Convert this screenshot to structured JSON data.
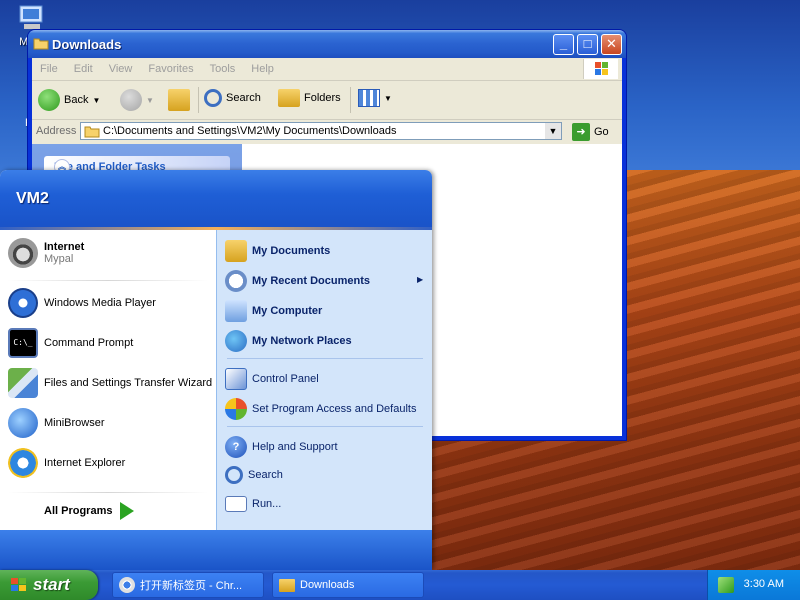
{
  "desktop": {
    "icons": [
      {
        "label": "My C",
        "icon": "my-computer-icon"
      },
      {
        "label": "Re",
        "icon": "recycle-bin-icon"
      }
    ]
  },
  "explorer": {
    "title": "Downloads",
    "menus": [
      "File",
      "Edit",
      "View",
      "Favorites",
      "Tools",
      "Help"
    ],
    "toolbar": {
      "back": "Back",
      "search": "Search",
      "folders": "Folders"
    },
    "address": {
      "label": "Address",
      "value": "C:\\Documents and Settings\\VM2\\My Documents\\Downloads",
      "go": "Go"
    },
    "tasks": {
      "header": "File and Folder Tasks"
    }
  },
  "start_menu": {
    "user": "VM2",
    "left": {
      "pinned": [
        {
          "label": "Internet",
          "sub": "Mypal",
          "icon": "raccoon-icon"
        }
      ],
      "recent": [
        {
          "label": "Windows Media Player",
          "icon": "media-player-icon"
        },
        {
          "label": "Command Prompt",
          "icon": "command-prompt-icon"
        },
        {
          "label": "Files and Settings Transfer Wizard",
          "icon": "transfer-wizard-icon"
        },
        {
          "label": "MiniBrowser",
          "icon": "minibrowser-icon"
        },
        {
          "label": "Internet Explorer",
          "icon": "ie-icon"
        }
      ],
      "all_programs": "All Programs"
    },
    "right": {
      "items": [
        {
          "label": "My Documents",
          "bold": true,
          "icon": "my-documents-icon"
        },
        {
          "label": "My Recent Documents",
          "bold": true,
          "icon": "recent-documents-icon"
        },
        {
          "label": "My Computer",
          "bold": true,
          "icon": "my-computer-icon"
        },
        {
          "label": "My Network Places",
          "bold": true,
          "icon": "network-places-icon"
        },
        {
          "label": "Control Panel",
          "bold": false,
          "icon": "control-panel-icon"
        },
        {
          "label": "Set Program Access and Defaults",
          "bold": false,
          "icon": "program-access-icon"
        },
        {
          "label": "Help and Support",
          "bold": false,
          "icon": "help-icon"
        },
        {
          "label": "Search",
          "bold": false,
          "icon": "search-icon"
        },
        {
          "label": "Run...",
          "bold": false,
          "icon": "run-icon"
        }
      ]
    }
  },
  "taskbar": {
    "start_label": "start",
    "tasks": [
      {
        "label": "打开新标签页 - Chr...",
        "icon": "chrome-icon"
      },
      {
        "label": "Downloads",
        "icon": "folder-icon"
      }
    ],
    "clock": "3:30 AM"
  }
}
